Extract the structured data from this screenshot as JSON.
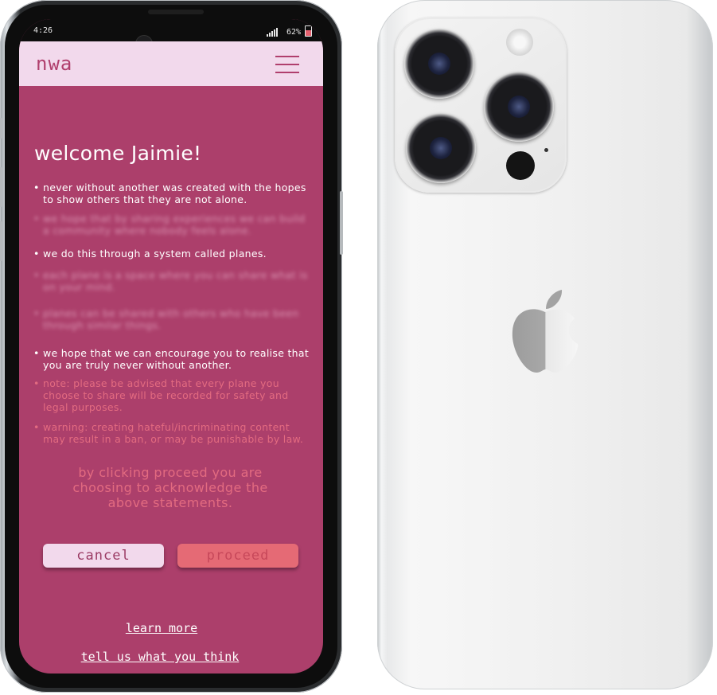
{
  "status_bar": {
    "time": "4:26",
    "battery": "62%"
  },
  "app": {
    "logo": "nwa",
    "menu_icon": "hamburger-menu-icon"
  },
  "welcome": {
    "title": "welcome Jaimie!"
  },
  "bullets": [
    "never without another was created with the hopes to show others that they are not alone.",
    "we do this through a system called planes.",
    "we hope that we can encourage you to realise that you are truly never without another.",
    "note: please be advised that every plane you choose to share will be recorded for safety and legal purposes.",
    "warning: creating hateful/incriminating content may result in a ban, or may be punishable by law."
  ],
  "acknowledge_text": "by clicking proceed you are choosing to acknowledge the above statements.",
  "buttons": {
    "cancel": "cancel",
    "proceed": "proceed"
  },
  "links": {
    "learn_more": "learn more",
    "feedback": "tell us what you think"
  },
  "colors": {
    "screen_bg": "#ac3f6b",
    "appbar_bg": "#f2d9ec",
    "accent": "#b03f6d",
    "note_text": "#e36b80",
    "proceed_bg": "#e56a75"
  }
}
